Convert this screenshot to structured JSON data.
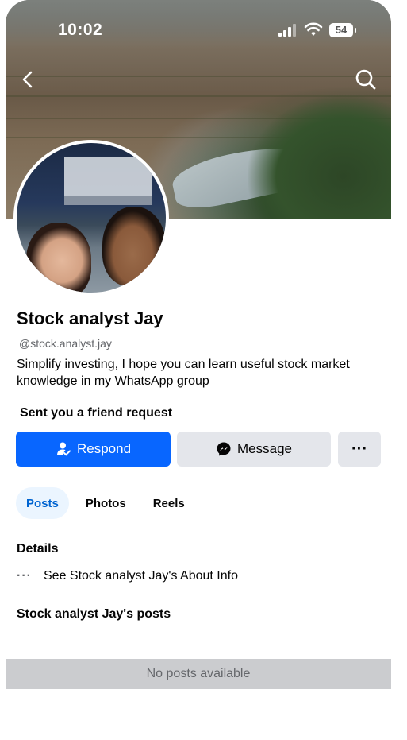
{
  "status_bar": {
    "time": "10:02",
    "battery": "54",
    "icons": [
      "signal-icon",
      "wifi-icon",
      "battery-icon"
    ]
  },
  "nav": {
    "back_icon": "chevron-left-icon",
    "search_icon": "search-icon"
  },
  "profile": {
    "name": "Stock analyst Jay",
    "handle": "@stock.analyst.jay",
    "bio": "Simplify investing, I hope you can learn useful stock market knowledge in my WhatsApp group",
    "friend_request_text": "Sent you a friend request"
  },
  "actions": {
    "respond_label": "Respond",
    "message_label": "Message",
    "more_label": "···"
  },
  "tabs": [
    {
      "label": "Posts",
      "active": true
    },
    {
      "label": "Photos",
      "active": false
    },
    {
      "label": "Reels",
      "active": false
    }
  ],
  "details": {
    "heading": "Details",
    "about_dots": "···",
    "about_link": "See Stock analyst Jay's About Info"
  },
  "posts": {
    "heading": "Stock analyst Jay's posts",
    "empty_text": "No posts available"
  },
  "colors": {
    "primary": "#0866ff",
    "secondary_button": "#e4e6eb",
    "active_tab_bg": "#ebf5ff",
    "active_tab_text": "#0064d1",
    "empty_banner": "#cbcccf"
  }
}
